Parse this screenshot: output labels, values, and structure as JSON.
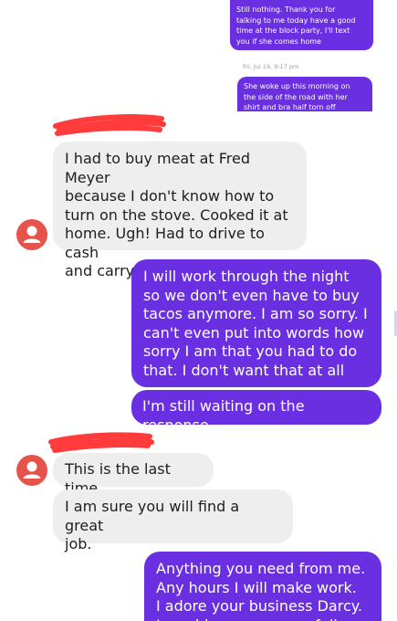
{
  "colors": {
    "outgoing_bubble": "#6a2fe0",
    "incoming_bubble": "#eeeeee",
    "avatar": "#e5534b",
    "redaction": "#ff3b3b"
  },
  "timestamp": "Fri, Jul 19, 9:17 pm",
  "messages": [
    {
      "side": "out",
      "text": "Still nothing. Thank you for\ntalking to me today have a good\ntime at the block party, I'll text\nyou if she comes home"
    },
    {
      "side": "out",
      "text": "She woke up this morning on\nthe side of the road with her\nshirt and bra half torn off"
    },
    {
      "side": "in",
      "text": "I had to buy meat at Fred Meyer\nbecause I don't know how to\nturn on the stove. Cooked it at\nhome. Ugh! Had to drive to cash\nand carry for missing supplies"
    },
    {
      "side": "out",
      "text": "I will work through the night\nso we don't even have to buy\ntacos anymore. I am so sorry. I\ncan't even put into words how\nsorry I am that you had to do\nthat. I don't want that at all"
    },
    {
      "side": "out",
      "text": "I'm still waiting on the response."
    },
    {
      "side": "in",
      "text": "This is the last time"
    },
    {
      "side": "in",
      "text": "I am sure you will find a great\njob."
    },
    {
      "side": "out",
      "text": "Anything you need from me.\nAny hours I will make work.\nI adore your business Darcy.\nI would never go overfull"
    }
  ],
  "icons": {
    "avatar": "person-icon",
    "redaction": "redaction-scribble"
  }
}
